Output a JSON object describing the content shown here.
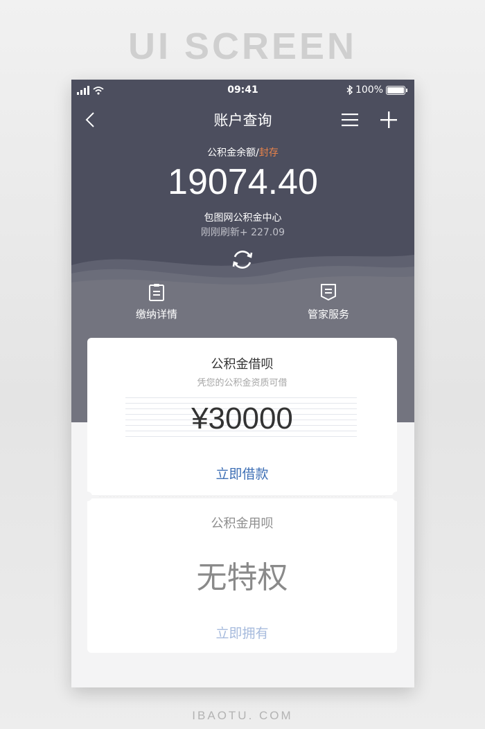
{
  "page": {
    "heading": "UI SCREEN",
    "footer": "IBAOTU. COM"
  },
  "status_bar": {
    "time": "09:41",
    "battery": "100%"
  },
  "nav": {
    "title": "账户查询"
  },
  "balance": {
    "label": "公积金余额",
    "separator": "/",
    "frozen_label": "封存",
    "amount": "19074.40",
    "center_name": "包图网公积金中心",
    "refresh_text": "刚刚刷新+ 227.09"
  },
  "shortcuts": [
    {
      "label": "缴纳详情",
      "icon": "clipboard-icon"
    },
    {
      "label": "管家服务",
      "icon": "service-icon"
    }
  ],
  "loan_card": {
    "title": "公积金借呗",
    "subtitle": "凭您的公积金资质可借",
    "amount": "¥30000",
    "button": "立即借款"
  },
  "use_card": {
    "title": "公积金用呗",
    "status": "无特权",
    "button": "立即拥有"
  },
  "colors": {
    "header_bg": "#4c4e5e",
    "accent_orange": "#e9834a",
    "link_blue": "#3e6fb5",
    "link_blue_muted": "#a7bbdd"
  }
}
